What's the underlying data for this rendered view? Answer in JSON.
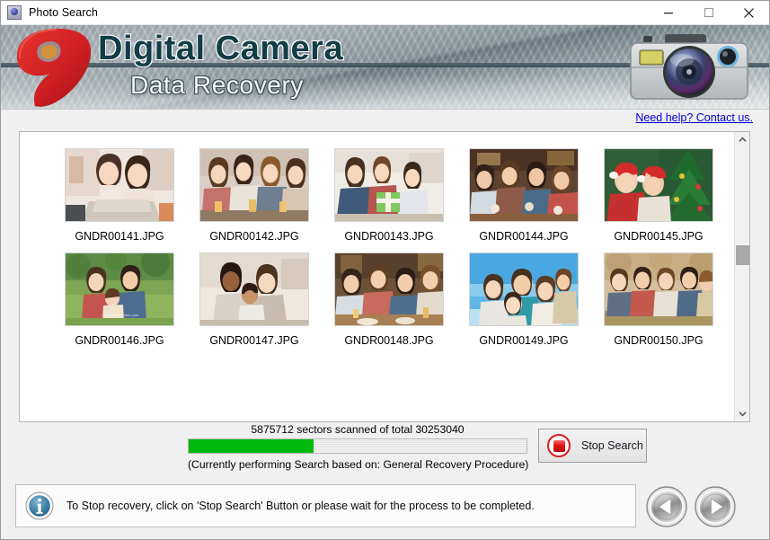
{
  "window": {
    "title": "Photo Search",
    "icon": "camera-app-icon",
    "controls": {
      "minimize": "minimize-icon",
      "maximize": "maximize-icon",
      "close": "close-icon"
    }
  },
  "banner": {
    "logo": "red-nine-swirl-logo",
    "line1": "Digital Camera",
    "line2": "Data Recovery",
    "camera_icon": "camera-illustration"
  },
  "help": {
    "link_label": "Need help? Contact us."
  },
  "thumbnails": {
    "rows": [
      [
        {
          "label": "GNDR00141.JPG",
          "scene": "two-women-laptop"
        },
        {
          "label": "GNDR00142.JPG",
          "scene": "friends-drinks-table"
        },
        {
          "label": "GNDR00143.JPG",
          "scene": "family-birthday-gift"
        },
        {
          "label": "GNDR00144.JPG",
          "scene": "group-cafe-toast"
        },
        {
          "label": "GNDR00145.JPG",
          "scene": "christmas-tree-santa-hats"
        }
      ],
      [
        {
          "label": "GNDR00146.JPG",
          "scene": "family-park-picnic"
        },
        {
          "label": "GNDR00147.JPG",
          "scene": "family-hug-indoor"
        },
        {
          "label": "GNDR00148.JPG",
          "scene": "friends-restaurant-table"
        },
        {
          "label": "GNDR00149.JPG",
          "scene": "family-blue-sky"
        },
        {
          "label": "GNDR00150.JPG",
          "scene": "friends-autumn-outdoors"
        }
      ]
    ],
    "scrollbar": {
      "up_arrow": "chevron-up-icon",
      "down_arrow": "chevron-down-icon"
    }
  },
  "progress": {
    "caption": "5875712 sectors scanned of total 30253040",
    "sectors_scanned": 5875712,
    "sectors_total": 30253040,
    "percent": 37,
    "fill_color": "#00b90b",
    "sub_caption": "(Currently performing Search based on:  General Recovery Procedure)"
  },
  "stop_button": {
    "label": "Stop Search",
    "icon": "stop-square-icon"
  },
  "info_bar": {
    "icon": "info-icon",
    "message": "To Stop recovery, click on 'Stop Search' Button or please wait for the process to be completed."
  },
  "nav": {
    "back": "back-arrow-icon",
    "next": "next-arrow-icon"
  }
}
